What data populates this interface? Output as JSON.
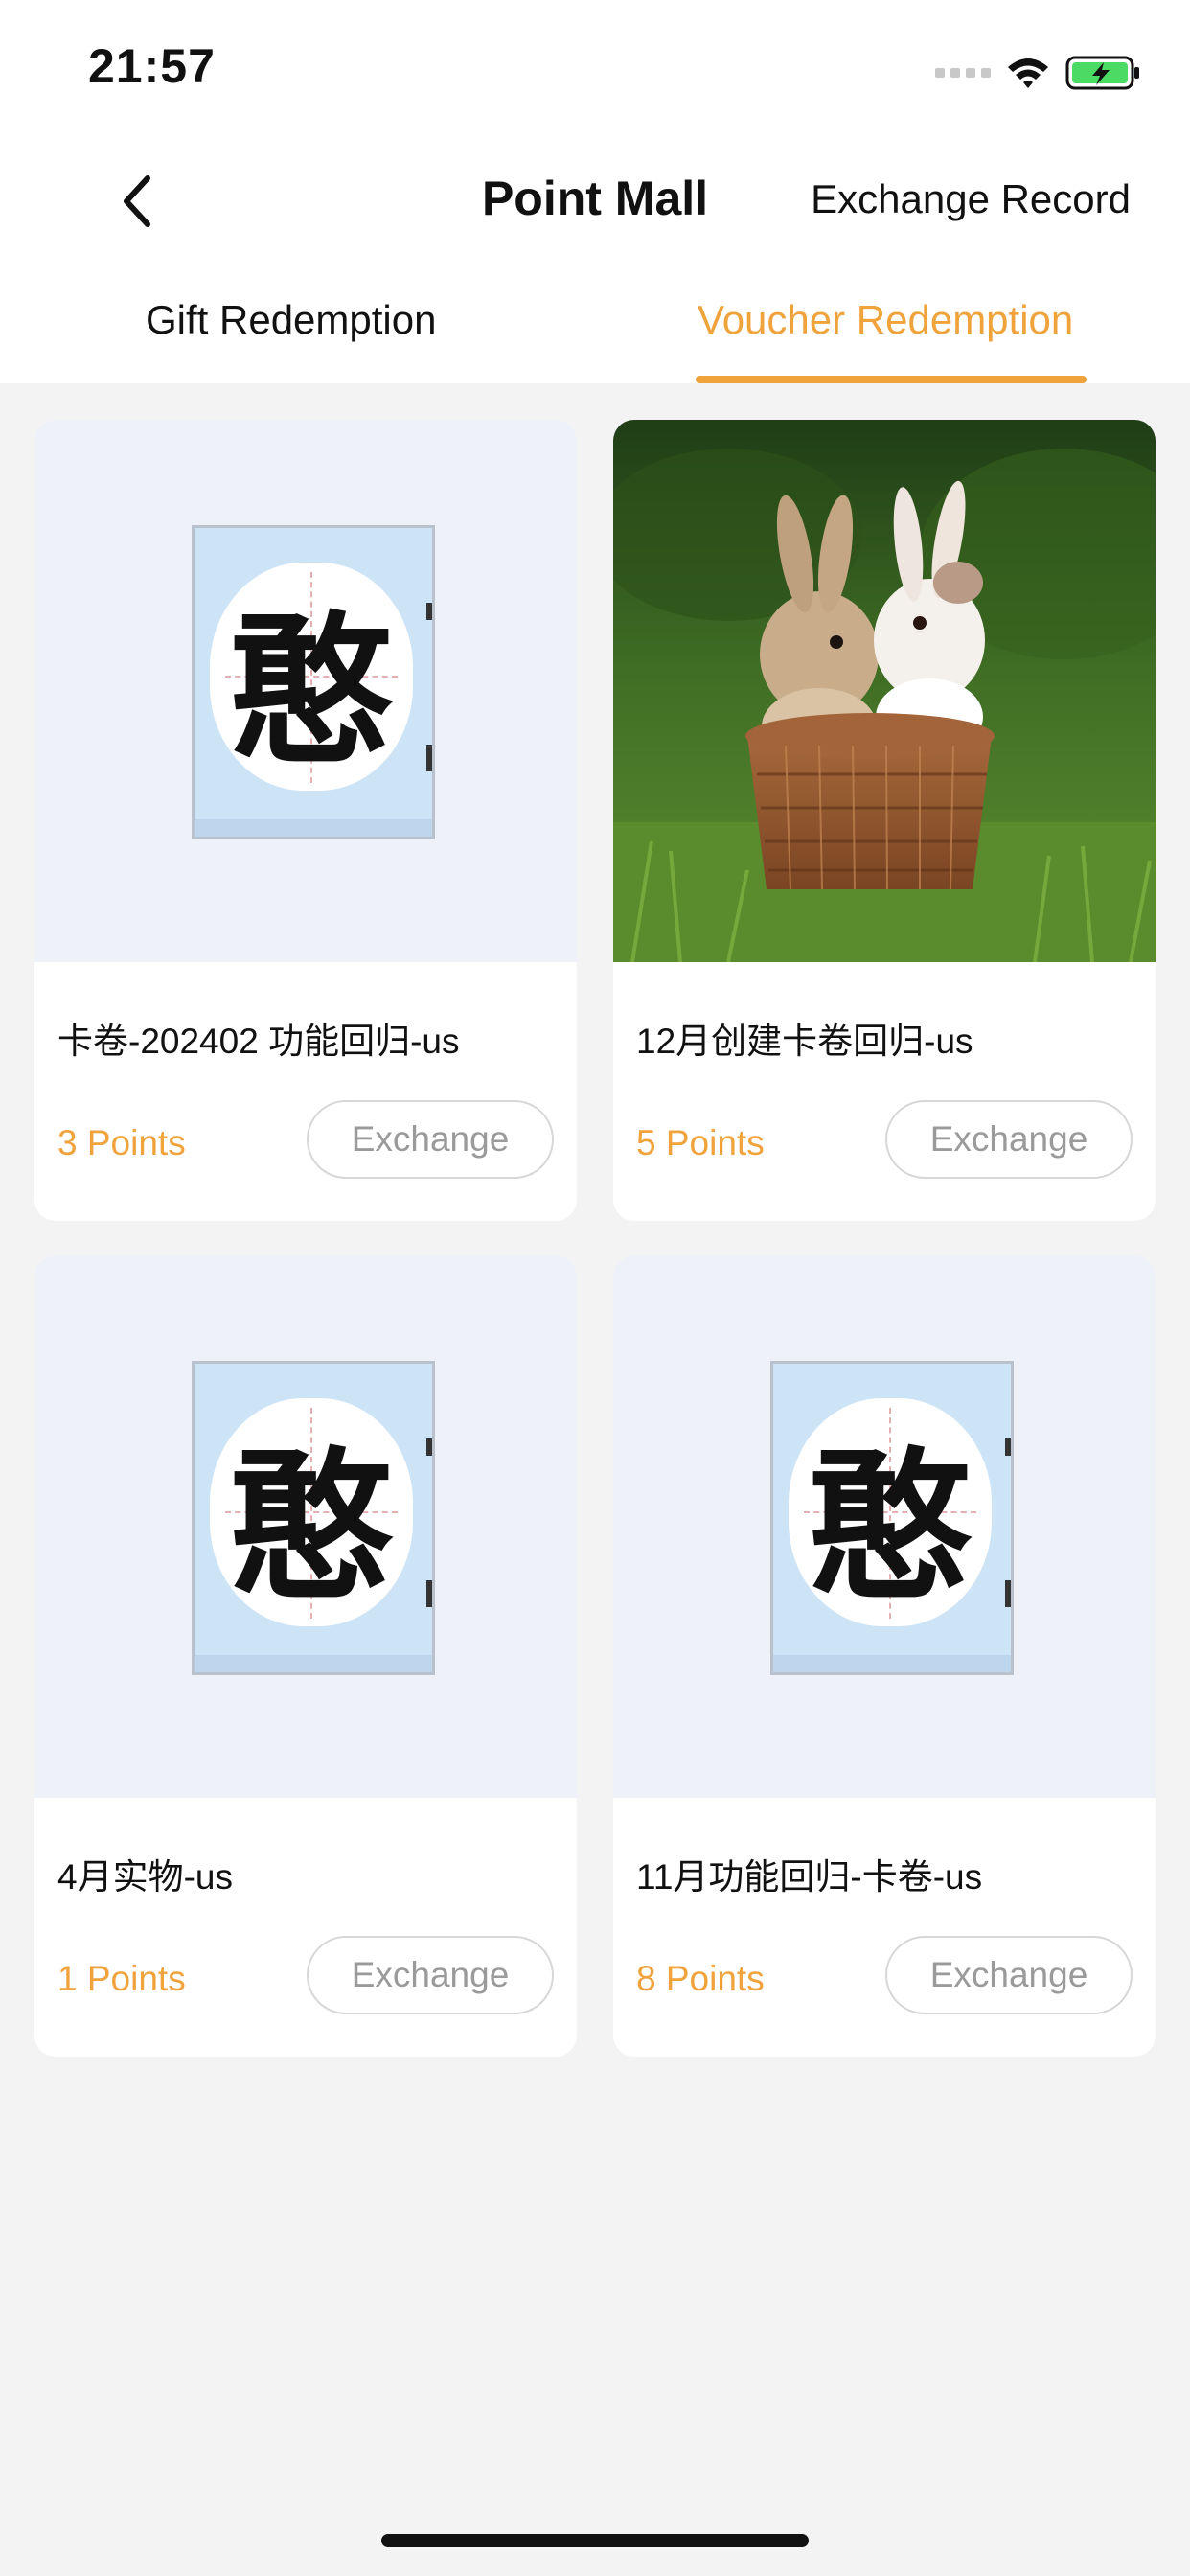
{
  "status_bar": {
    "time": "21:57",
    "icons": [
      "cellular-signal-icon",
      "wifi-icon",
      "battery-charging-icon"
    ],
    "battery_color": "#4cd964"
  },
  "nav": {
    "back_icon": "chevron-left-icon",
    "title": "Point Mall",
    "record_label": "Exchange Record"
  },
  "tabs": {
    "items": [
      {
        "label": "Gift Redemption",
        "active": false
      },
      {
        "label": "Voucher Redemption",
        "active": true
      }
    ],
    "active_color": "#f0a23b"
  },
  "products": [
    {
      "title": "卡卷-202402 功能回归-us",
      "points": "3 Points",
      "button": "Exchange",
      "image": "glyph-image",
      "image_glyph": "憨"
    },
    {
      "title": "12月创建卡卷回归-us",
      "points": "5 Points",
      "button": "Exchange",
      "image": "rabbits-in-basket-photo"
    },
    {
      "title": "4月实物-us",
      "points": "1 Points",
      "button": "Exchange",
      "image": "glyph-image",
      "image_glyph": "憨"
    },
    {
      "title": "11月功能回归-卡卷-us",
      "points": "8 Points",
      "button": "Exchange",
      "image": "glyph-image",
      "image_glyph": "憨"
    }
  ]
}
